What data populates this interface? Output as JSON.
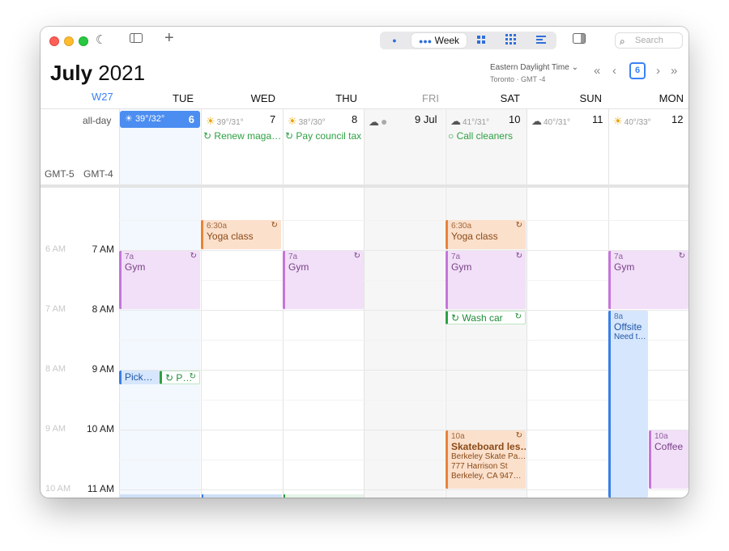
{
  "toolbar": {
    "view_label": "Week",
    "search_placeholder": "Search"
  },
  "header": {
    "month": "July",
    "year": "2021",
    "timezone": "Eastern Daylight Time",
    "timezone_sub": "Toronto · GMT -4",
    "today_number": "6"
  },
  "week_label": "W27",
  "allday_label": "all-day",
  "gmt": [
    "GMT-5",
    "GMT-4"
  ],
  "days": [
    {
      "name": "TUE",
      "num": "6",
      "weather": "39°/32°"
    },
    {
      "name": "WED",
      "num": "7",
      "weather": "39°/31°"
    },
    {
      "name": "THU",
      "num": "8",
      "weather": "38°/30°"
    },
    {
      "name": "FRI",
      "num": "9 Jul",
      "weather": ""
    },
    {
      "name": "SAT",
      "num": "10",
      "weather": "41°/31°"
    },
    {
      "name": "SUN",
      "num": "11",
      "weather": "40°/31°"
    },
    {
      "name": "MON",
      "num": "12",
      "weather": "40°/33°"
    }
  ],
  "allday_events": {
    "wed": "Renew maga…",
    "thu": "Pay council tax",
    "sat": "Call cleaners"
  },
  "hours": [
    {
      "main": "7 AM",
      "faint": "6 AM"
    },
    {
      "main": "8 AM",
      "faint": "7 AM"
    },
    {
      "main": "9 AM",
      "faint": "8 AM"
    },
    {
      "main": "10 AM",
      "faint": "9 AM"
    },
    {
      "main": "11 AM",
      "faint": "10 AM"
    }
  ],
  "events": {
    "yoga_wed": {
      "time": "6:30a",
      "name": "Yoga class"
    },
    "yoga_sat": {
      "time": "6:30a",
      "name": "Yoga class"
    },
    "gym_tue": {
      "time": "7a",
      "name": "Gym"
    },
    "gym_thu": {
      "time": "7a",
      "name": "Gym"
    },
    "gym_sat": {
      "time": "7a",
      "name": "Gym"
    },
    "gym_mon": {
      "time": "7a",
      "name": "Gym"
    },
    "wash_car": {
      "name": "Wash car"
    },
    "offsite": {
      "time": "8a",
      "name": "Offsite",
      "desc": "Need t…"
    },
    "pick": {
      "name": "Pick…"
    },
    "p": {
      "name": "P…"
    },
    "skate": {
      "time": "10a",
      "name": "Skateboard les…",
      "l1": "Berkeley Skate Pa…",
      "l2": "777 Harrison St",
      "l3": "Berkeley, CA 947…"
    },
    "coffee": {
      "time": "10a",
      "name": "Coffee"
    }
  }
}
